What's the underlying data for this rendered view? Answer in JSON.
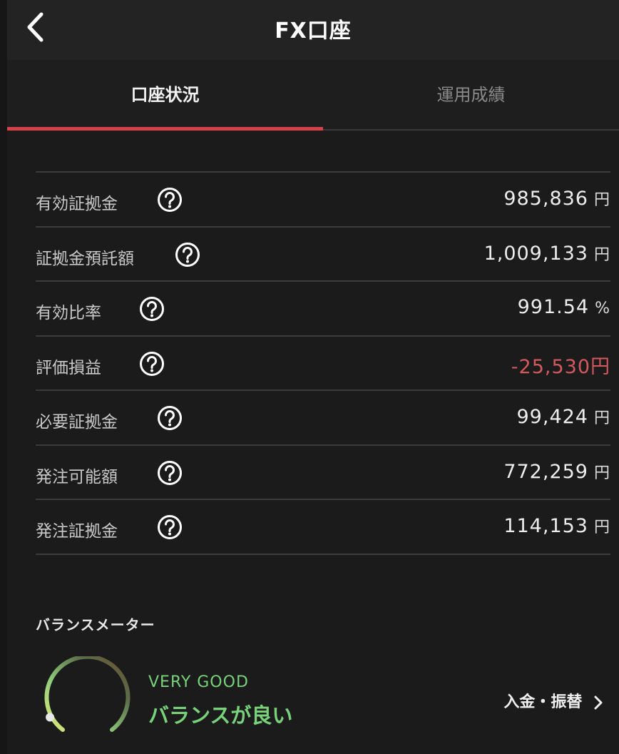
{
  "header": {
    "title": "FX口座"
  },
  "tabs": [
    {
      "label": "口座状況",
      "active": true
    },
    {
      "label": "運用成績",
      "active": false
    }
  ],
  "account_rows": [
    {
      "label": "有効証拠金",
      "value": "985,836",
      "unit": "円"
    },
    {
      "label": "証拠金預託額",
      "value": "1,009,133",
      "unit": "円"
    },
    {
      "label": "有効比率",
      "value": "991.54",
      "unit": "%"
    },
    {
      "label": "評価損益",
      "value": "-25,530",
      "unit": "円",
      "negative": true
    },
    {
      "label": "必要証拠金",
      "value": "99,424",
      "unit": "円"
    },
    {
      "label": "発注可能額",
      "value": "772,259",
      "unit": "円"
    },
    {
      "label": "発注証拠金",
      "value": "114,153",
      "unit": "円"
    }
  ],
  "balance_meter": {
    "title": "バランスメーター",
    "grade": "VERY GOOD",
    "status_text": "バランスが良い",
    "level": 0.1
  },
  "transfer_link": {
    "label": "入金・振替"
  },
  "colors": {
    "accent": "#d8404a",
    "negative": "#d4595d",
    "good": "#77d27a",
    "background": "#1b1b1b"
  },
  "icons": [
    "back-chevron-icon",
    "question-circle-icon",
    "chevron-right-icon"
  ]
}
